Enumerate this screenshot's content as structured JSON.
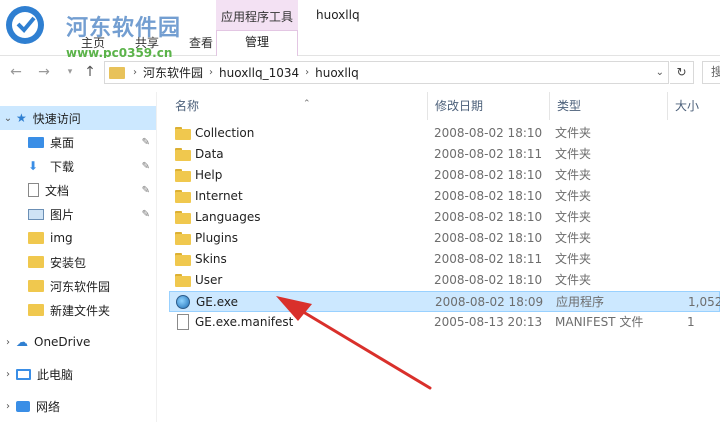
{
  "ribbon": {
    "watermark": "河东软件园",
    "watermark_url": "www.pc0359.cn",
    "tabs": [
      "主页",
      "共享",
      "查看"
    ],
    "context_group": "应用程序工具",
    "context_tab": "管理",
    "window_title": "huoxllq"
  },
  "address": {
    "crumbs": [
      "河东软件园",
      "huoxllq_1034",
      "huoxllq"
    ],
    "search_placeholder": "搜"
  },
  "nav": {
    "quick_access": "快速访问",
    "items": [
      {
        "label": "桌面",
        "icon": "desktop-icon",
        "pinned": true
      },
      {
        "label": "下载",
        "icon": "download-icon",
        "pinned": true
      },
      {
        "label": "文档",
        "icon": "document-icon",
        "pinned": true
      },
      {
        "label": "图片",
        "icon": "picture-icon",
        "pinned": true
      },
      {
        "label": "img",
        "icon": "folder-icon",
        "pinned": false
      },
      {
        "label": "安装包",
        "icon": "folder-icon",
        "pinned": false
      },
      {
        "label": "河东软件园",
        "icon": "folder-icon",
        "pinned": false
      },
      {
        "label": "新建文件夹",
        "icon": "folder-icon",
        "pinned": false
      }
    ],
    "onedrive": "OneDrive",
    "this_pc": "此电脑",
    "network": "网络"
  },
  "columns": {
    "name": "名称",
    "date": "修改日期",
    "type": "类型",
    "size": "大小"
  },
  "files": [
    {
      "name": "Collection",
      "date": "2008-08-02 18:10",
      "type": "文件夹",
      "size": "",
      "kind": "folder"
    },
    {
      "name": "Data",
      "date": "2008-08-02 18:11",
      "type": "文件夹",
      "size": "",
      "kind": "folder"
    },
    {
      "name": "Help",
      "date": "2008-08-02 18:10",
      "type": "文件夹",
      "size": "",
      "kind": "folder"
    },
    {
      "name": "Internet",
      "date": "2008-08-02 18:10",
      "type": "文件夹",
      "size": "",
      "kind": "folder"
    },
    {
      "name": "Languages",
      "date": "2008-08-02 18:10",
      "type": "文件夹",
      "size": "",
      "kind": "folder"
    },
    {
      "name": "Plugins",
      "date": "2008-08-02 18:10",
      "type": "文件夹",
      "size": "",
      "kind": "folder"
    },
    {
      "name": "Skins",
      "date": "2008-08-02 18:11",
      "type": "文件夹",
      "size": "",
      "kind": "folder"
    },
    {
      "name": "User",
      "date": "2008-08-02 18:10",
      "type": "文件夹",
      "size": "",
      "kind": "folder"
    },
    {
      "name": "GE.exe",
      "date": "2008-08-02 18:09",
      "type": "应用程序",
      "size": "1,052",
      "kind": "exe"
    },
    {
      "name": "GE.exe.manifest",
      "date": "2005-08-13 20:13",
      "type": "MANIFEST 文件",
      "size": "1",
      "kind": "doc"
    }
  ],
  "colors": {
    "selection": "#cce8ff",
    "context_tab": "#f3e1f3",
    "arrow": "#d9302b"
  }
}
